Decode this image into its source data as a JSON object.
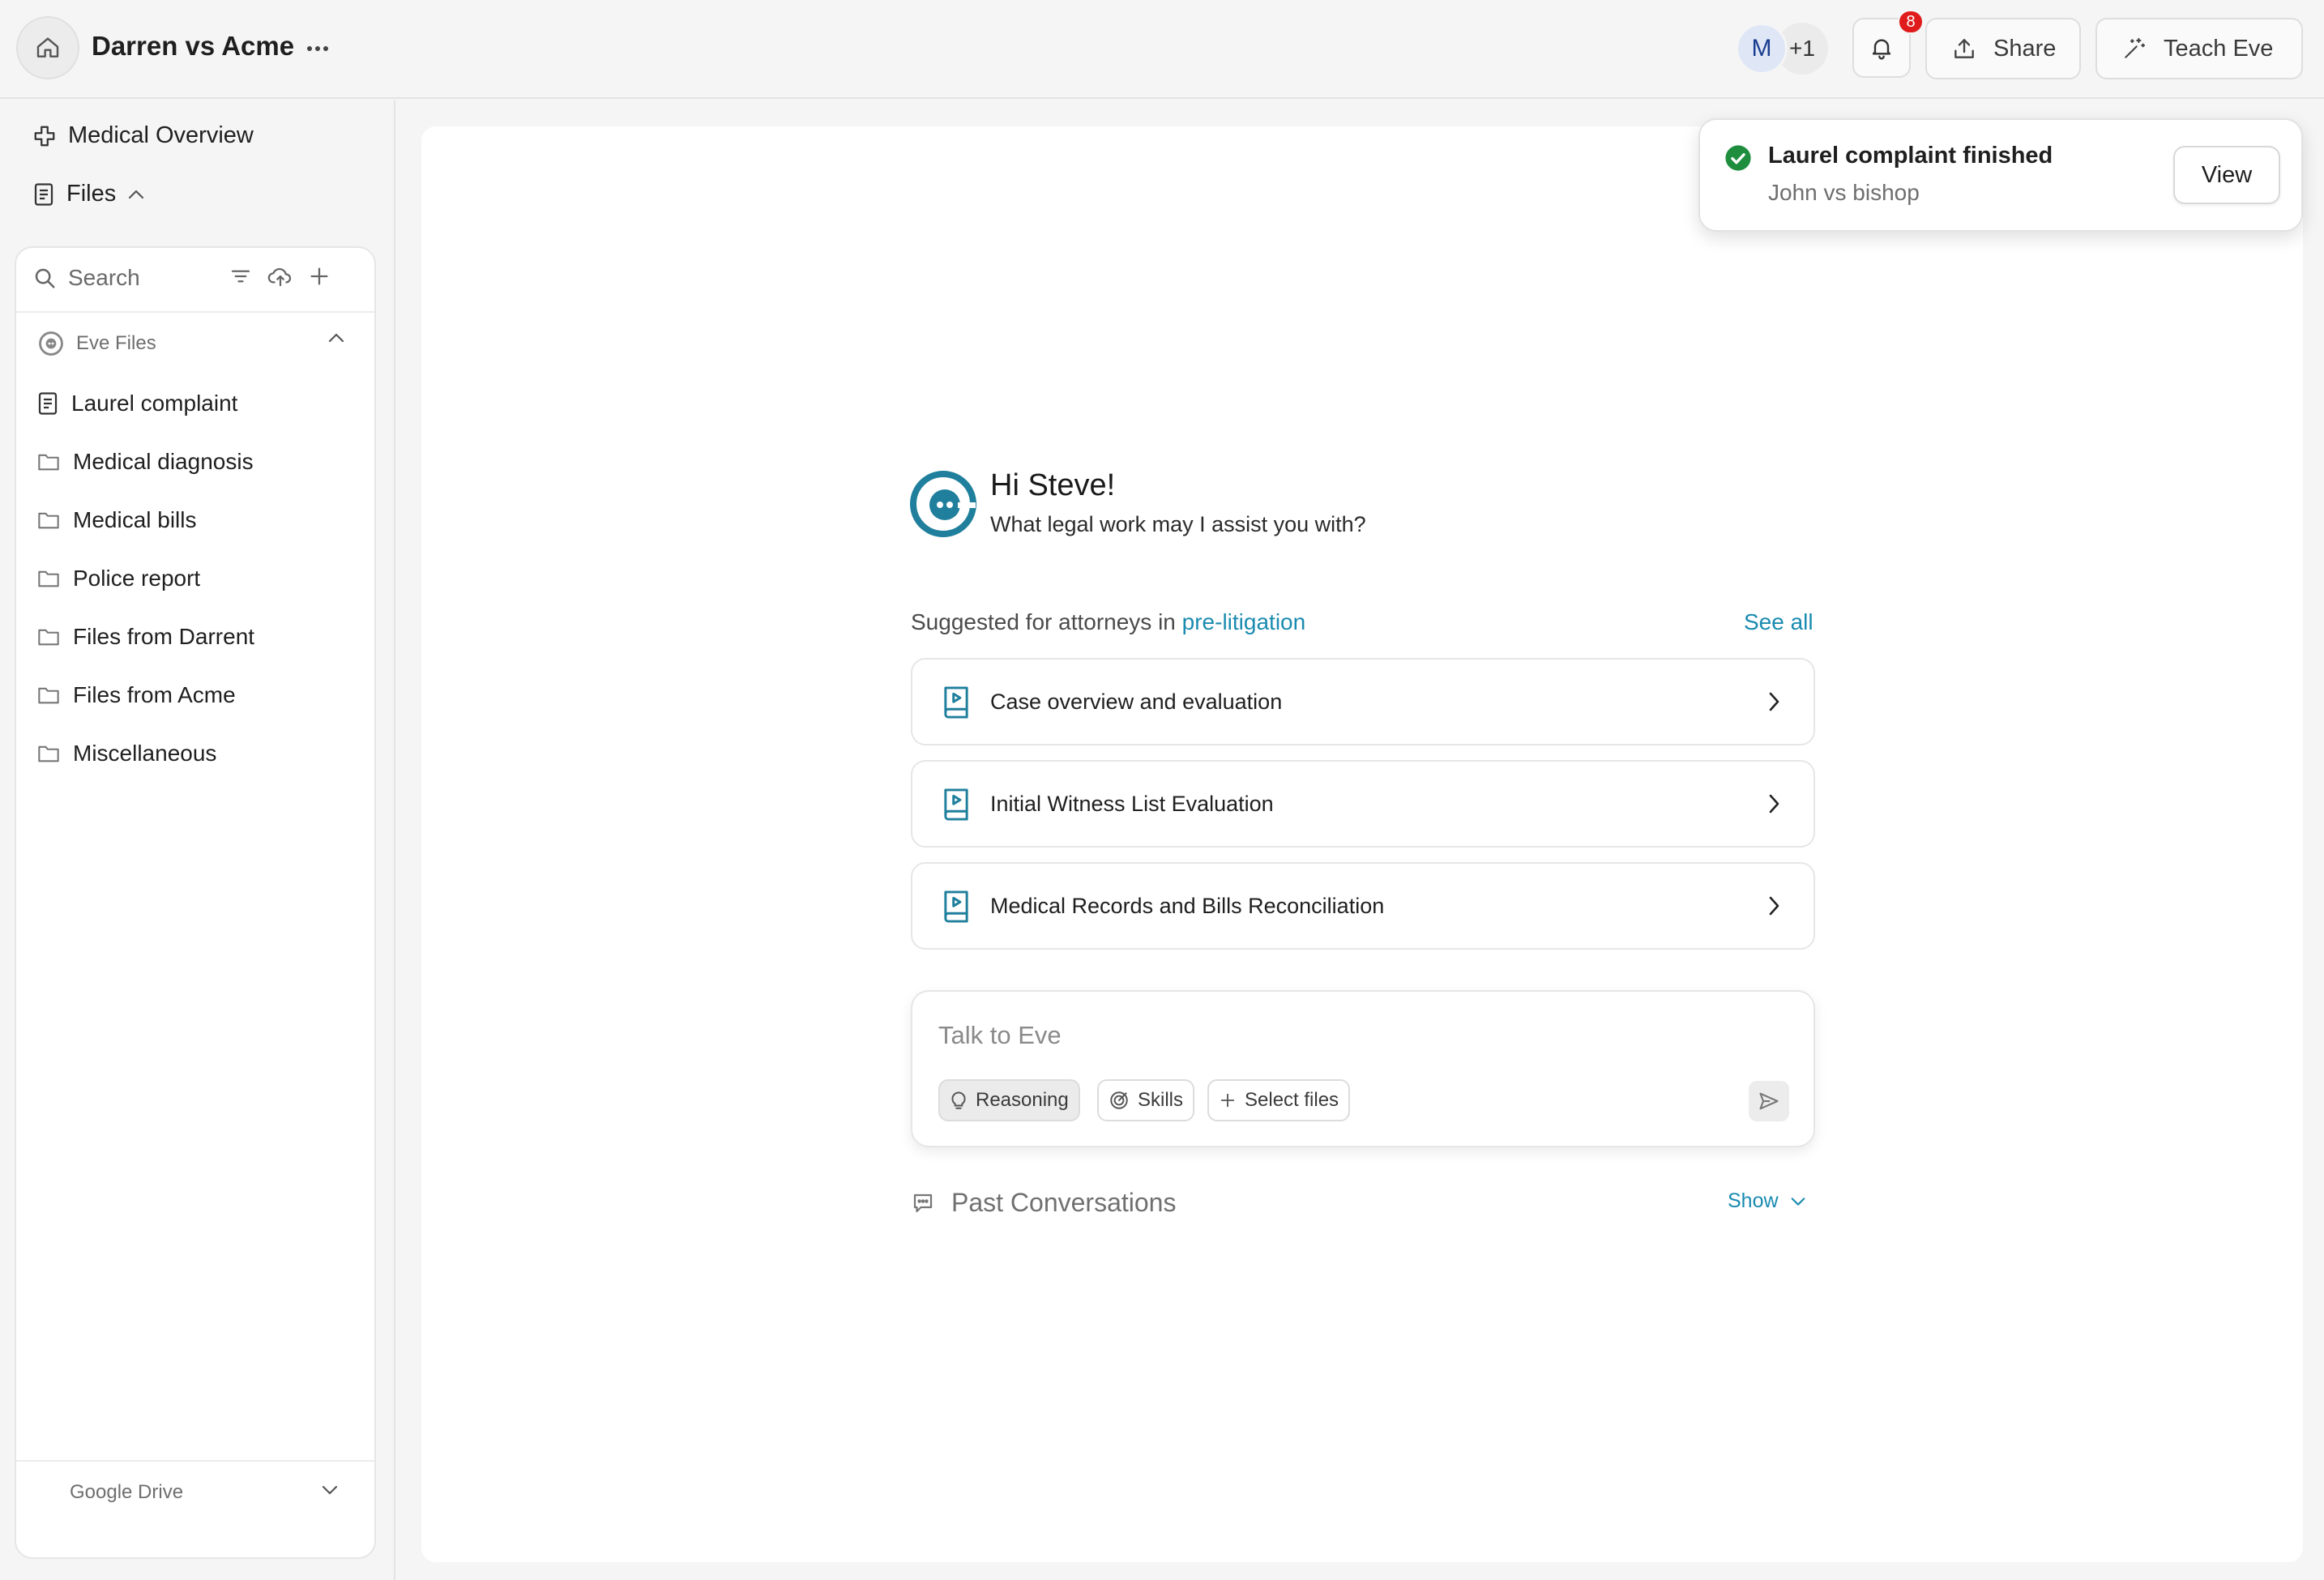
{
  "header": {
    "case_title": "Darren vs Acme",
    "avatar_initial": "M",
    "avatar_more": "+1",
    "notification_count": "8",
    "share_label": "Share",
    "teach_label": "Teach Eve"
  },
  "sidebar": {
    "overview_label": "Medical Overview",
    "files_label": "Files",
    "search_placeholder": "Search",
    "eve_files_label": "Eve Files",
    "items": [
      {
        "label": "Laurel complaint",
        "icon": "document-icon"
      },
      {
        "label": "Medical diagnosis",
        "icon": "folder-icon"
      },
      {
        "label": "Medical bills",
        "icon": "folder-icon"
      },
      {
        "label": "Police report",
        "icon": "folder-icon"
      },
      {
        "label": "Files from Darrent",
        "icon": "folder-icon"
      },
      {
        "label": "Files from Acme",
        "icon": "folder-icon"
      },
      {
        "label": "Miscellaneous",
        "icon": "folder-icon"
      }
    ],
    "google_drive_label": "Google Drive"
  },
  "main": {
    "greeting_title": "Hi Steve!",
    "greeting_subtitle": "What legal work may I assist you with?",
    "suggested_prefix": "Suggested for attorneys in ",
    "suggested_highlight": "pre-litigation",
    "see_all_label": "See all",
    "suggestions": [
      {
        "label": "Case overview and evaluation"
      },
      {
        "label": "Initial Witness List Evaluation"
      },
      {
        "label": "Medical Records and Bills Reconciliation"
      }
    ],
    "chat": {
      "placeholder": "Talk to Eve",
      "reasoning_label": "Reasoning",
      "skills_label": "Skills",
      "select_files_label": "Select files"
    },
    "past_conversations_label": "Past Conversations",
    "show_label": "Show"
  },
  "toast": {
    "title": "Laurel complaint finished",
    "subtitle": "John vs bishop",
    "view_label": "View"
  },
  "colors": {
    "accent": "#1a8bb0",
    "brand_teal": "#1f7f9c",
    "success": "#1e8e3e",
    "badge_red": "#e01b1b"
  }
}
